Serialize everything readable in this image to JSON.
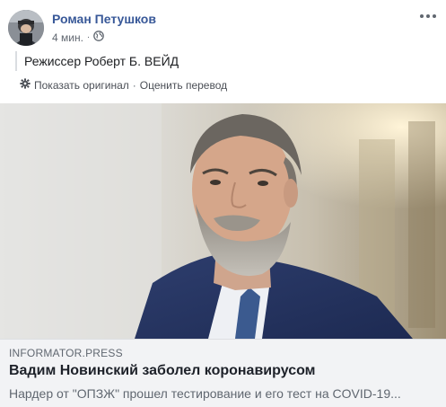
{
  "post": {
    "author": "Роман Петушков",
    "time": "4 мин.",
    "separator": "·",
    "privacy_icon": "globe-icon",
    "more_icon": "more-horizontal-icon"
  },
  "translation": {
    "text": "Режиссер Роберт Б. ВЕЙД",
    "settings_icon": "gear-icon",
    "show_original": "Показать оригинал",
    "separator": "·",
    "rate_translation": "Оценить перевод"
  },
  "link_preview": {
    "domain": "INFORMATOR.PRESS",
    "title": "Вадим Новинский заболел коронавирусом",
    "description": "Нардер от \"ОПЗЖ\" прошел тестирование и его тест на COVID-19..."
  },
  "colors": {
    "author_link": "#385898",
    "secondary_text": "#606770",
    "caption_bg": "#f2f3f5",
    "primary_text": "#1d2129"
  }
}
